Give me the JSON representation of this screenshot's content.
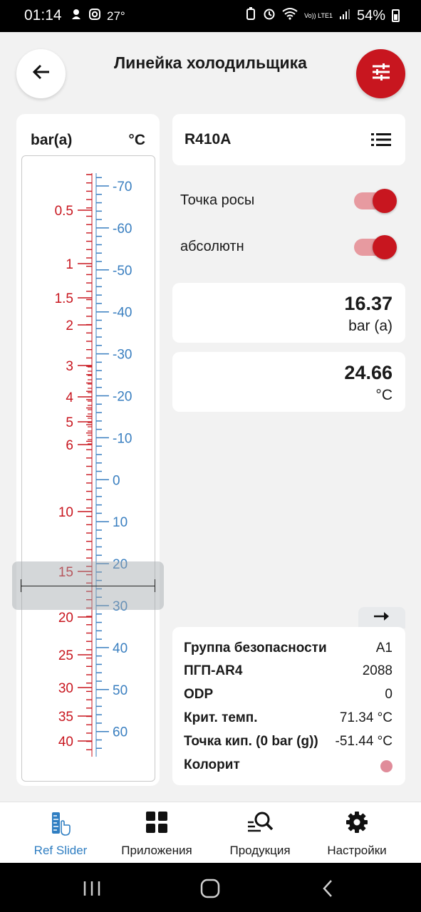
{
  "status_bar": {
    "time": "01:14",
    "temperature": "27°",
    "network": "Vo)) LTE1",
    "battery": "54%"
  },
  "header": {
    "title": "Линейка холодильщика"
  },
  "ruler": {
    "unit_pressure": "bar(a)",
    "unit_temperature": "°C",
    "pressure_color": "#c8161f",
    "temperature_color": "#3a7fc0",
    "pressure_labels": [
      "0.5",
      "1",
      "1.5",
      "2",
      "3",
      "4",
      "5",
      "6",
      "10",
      "15",
      "20",
      "25",
      "30",
      "35",
      "40"
    ],
    "temperature_labels": [
      "-70",
      "-60",
      "-50",
      "-40",
      "-30",
      "-20",
      "-10",
      "0",
      "10",
      "20",
      "30",
      "40",
      "50",
      "60"
    ]
  },
  "refrigerant": {
    "name": "R410A"
  },
  "toggles": [
    {
      "label": "Точка росы",
      "on": true
    },
    {
      "label": "абсолютн",
      "on": true
    }
  ],
  "pressure_value": {
    "value": "16.37",
    "unit": "bar (a)"
  },
  "temperature_value": {
    "value": "24.66",
    "unit": "°C"
  },
  "info": [
    {
      "key": "Группа безопасности",
      "value": "A1"
    },
    {
      "key": "ПГП-AR4",
      "value": "2088"
    },
    {
      "key": "ODP",
      "value": "0"
    },
    {
      "key": "Крит. темп.",
      "value": "71.34 °C"
    },
    {
      "key": "Точка кип. (0 bar (g))",
      "value": "-51.44 °C"
    },
    {
      "key": "Колорит",
      "value_color": "#e08c9a"
    }
  ],
  "nav": [
    {
      "label": "Ref Slider",
      "icon": "ruler-hand-icon",
      "active": true
    },
    {
      "label": "Приложения",
      "icon": "grid-icon",
      "active": false
    },
    {
      "label": "Продукция",
      "icon": "product-search-icon",
      "active": false
    },
    {
      "label": "Настройки",
      "icon": "gear-icon",
      "active": false
    }
  ]
}
